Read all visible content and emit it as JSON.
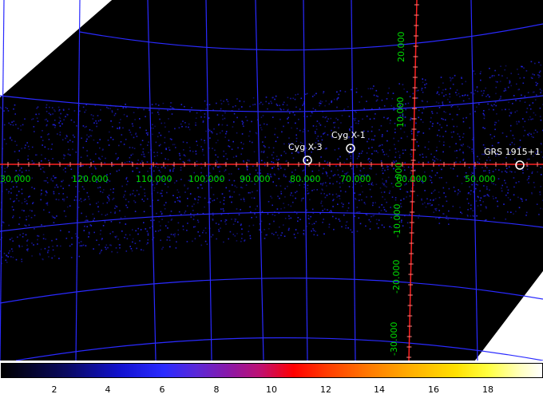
{
  "sources": [
    {
      "name": "Cyg X-3"
    },
    {
      "name": "Cyg X-1"
    },
    {
      "name": "GRS 1915+1"
    }
  ],
  "ra_labels": [
    "30.000",
    "120.000",
    "110.000",
    "100.000",
    "90.000",
    "80.000",
    "70.000",
    "60.000",
    "50.000"
  ],
  "dec_labels": [
    "20.000",
    "10.000",
    "0.000",
    "-10.000",
    "-20.000",
    "-30.000"
  ],
  "colorbar_ticks": [
    "2",
    "4",
    "6",
    "8",
    "10",
    "12",
    "14",
    "16",
    "18"
  ],
  "colors": {
    "background": "#000000",
    "grid": "#2a2aff",
    "axis": "#ff2020",
    "labels": "#00dd00",
    "source_marker": "#ffffff"
  }
}
